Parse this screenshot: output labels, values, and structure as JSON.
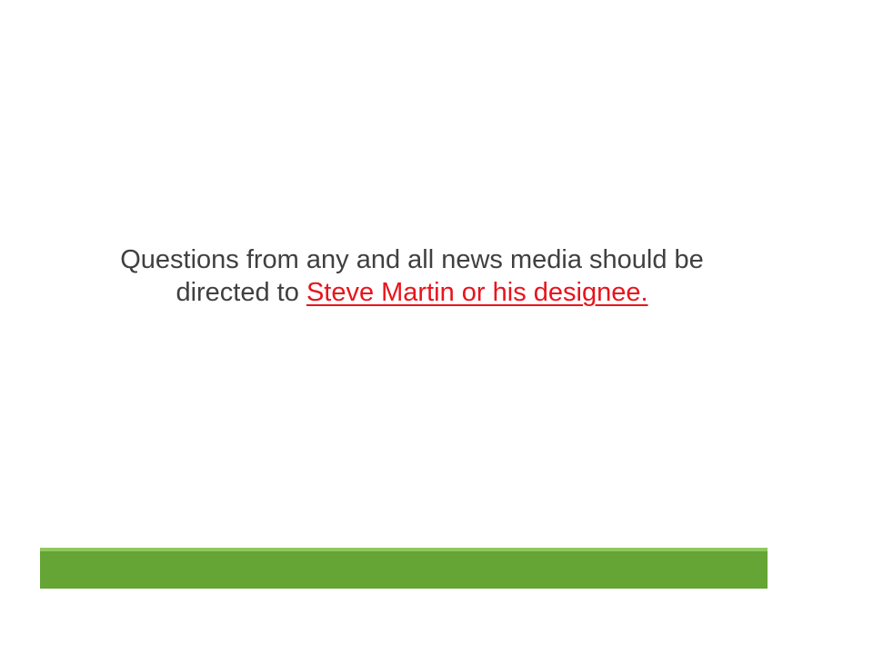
{
  "slide": {
    "text_line_1": "Questions from any and all news media should be",
    "text_line_2_prefix": "directed to ",
    "link_text": "Steve Martin or his designee."
  },
  "colors": {
    "body_text": "#404040",
    "link": "#e8141c",
    "footer_bar": "#64a535",
    "footer_bar_highlight": "#8fc85e"
  }
}
